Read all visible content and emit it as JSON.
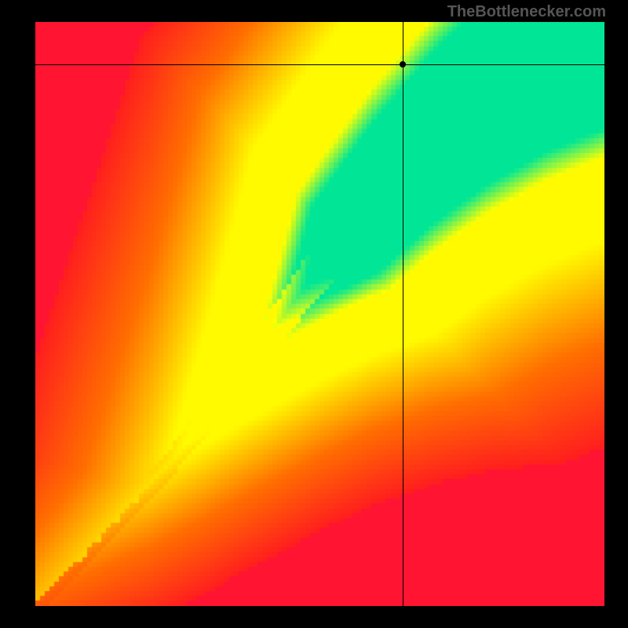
{
  "watermark": "TheBottlenecker.com",
  "chart_data": {
    "type": "heatmap",
    "title": "",
    "xlabel": "",
    "ylabel": "",
    "xlim": [
      0,
      1
    ],
    "ylim": [
      0,
      1
    ],
    "colorscale": "red-orange-yellow-green (bottleneck)",
    "description": "2D heatmap where green diagonal band indicates balanced component match; red regions indicate severe bottleneck; yellow/orange intermediate.",
    "crosshair": {
      "x": 0.645,
      "y": 0.072
    },
    "marker": {
      "x": 0.645,
      "y": 0.072
    },
    "optimal_band": {
      "note": "approximate centerline of green optimal region, nonlinear",
      "points": [
        {
          "x": 0.0,
          "y": 1.0
        },
        {
          "x": 0.1,
          "y": 0.9
        },
        {
          "x": 0.2,
          "y": 0.8
        },
        {
          "x": 0.3,
          "y": 0.68
        },
        {
          "x": 0.4,
          "y": 0.55
        },
        {
          "x": 0.5,
          "y": 0.42
        },
        {
          "x": 0.6,
          "y": 0.3
        },
        {
          "x": 0.7,
          "y": 0.2
        },
        {
          "x": 0.8,
          "y": 0.12
        },
        {
          "x": 0.9,
          "y": 0.06
        },
        {
          "x": 1.0,
          "y": 0.02
        }
      ]
    }
  },
  "canvas": {
    "grid": 120
  }
}
